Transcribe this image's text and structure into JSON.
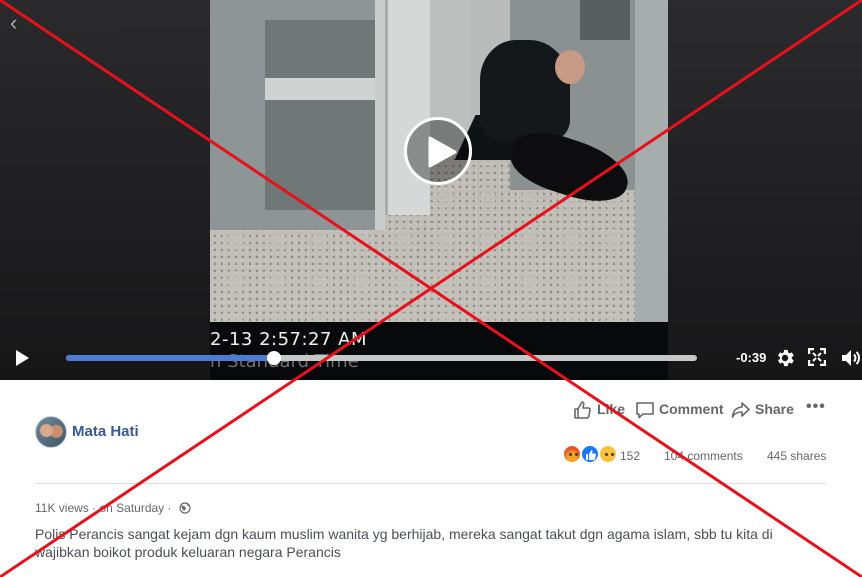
{
  "video": {
    "timestamp_overlay": "2-13 2:57:27 AM",
    "timezone_overlay": "n Standard Time",
    "time_remaining": "-0:39",
    "progress": 0.33
  },
  "post": {
    "page_name": "Mata Hati",
    "actions": {
      "like": "Like",
      "comment": "Comment",
      "share": "Share",
      "more": "•••"
    },
    "stats": {
      "reactions": "152",
      "comments": "104 comments",
      "shares": "445 shares"
    },
    "meta": "11K views · on Saturday ·",
    "caption": "Polis Perancis sangat kejam dgn kaum muslim wanita yg berhijab, mereka sangat takut dgn agama islam, sbb tu kita di wajibkan boikot produk keluaran negara Perancis"
  },
  "icons": {
    "back": "chevron-left-icon",
    "play_center": "play-icon",
    "play_control": "play-icon",
    "settings": "gear-icon",
    "fullscreen": "fullscreen-icon",
    "volume": "volume-icon",
    "like": "thumbs-up-icon",
    "comment": "comment-bubble-icon",
    "share": "share-arrow-icon",
    "audience": "globe-icon"
  },
  "colors": {
    "progress_fill": "#4b7ad8",
    "page_name": "#385898",
    "overlay_cross": "#e8111b",
    "secondary_text": "#65676b"
  }
}
